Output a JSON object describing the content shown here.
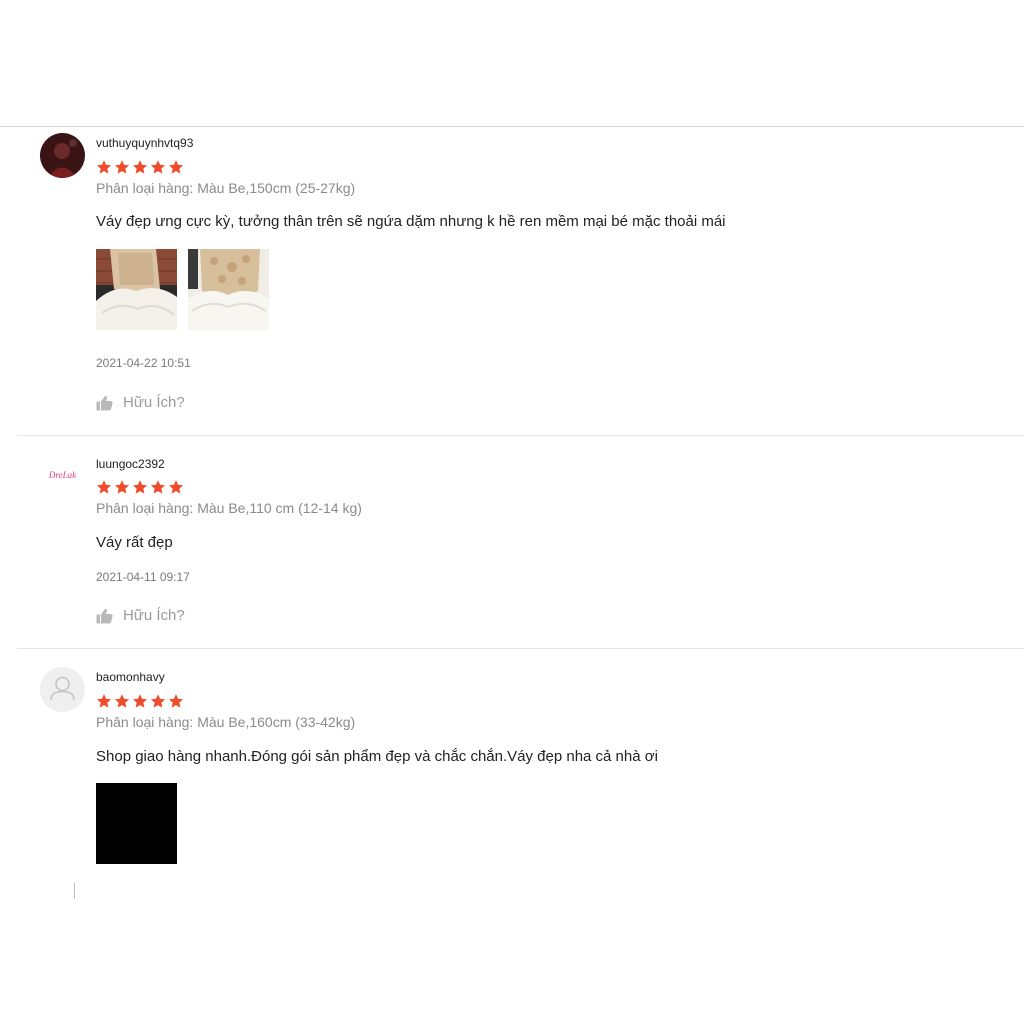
{
  "reviews": [
    {
      "username": "vuthuyquynhvtq93",
      "rating": 5,
      "variation": "Phân loại hàng: Màu Be,150cm (25-27kg)",
      "comment": "Váy đẹp ưng cực kỳ, tưởng thân trên sẽ ngứa dặm nhưng k hề ren mềm mại bé mặc thoải mái",
      "date": "2021-04-22 10:51",
      "helpful_label": "Hữu Ích?"
    },
    {
      "username": "luungoc2392",
      "avatar_logo_text": "DreLak",
      "rating": 5,
      "variation": "Phân loại hàng: Màu Be,110 cm (12-14 kg)",
      "comment": "Váy rất đẹp",
      "date": "2021-04-11 09:17",
      "helpful_label": "Hữu Ích?"
    },
    {
      "username": "baomonhavy",
      "rating": 5,
      "variation": "Phân loại hàng: Màu Be,160cm (33-42kg)",
      "comment": "Shop giao hàng nhanh.Đóng gói sản phẩm đẹp và chắc chắn.Váy đẹp nha cả nhà ơi"
    }
  ],
  "colors": {
    "star": "#ee4d2d",
    "muted_text": "#8a8a8a",
    "divider": "#e5e5e5"
  },
  "icons": {
    "star": "star-icon",
    "helpful": "thumbs-up-icon",
    "default_avatar": "user-silhouette-icon"
  }
}
